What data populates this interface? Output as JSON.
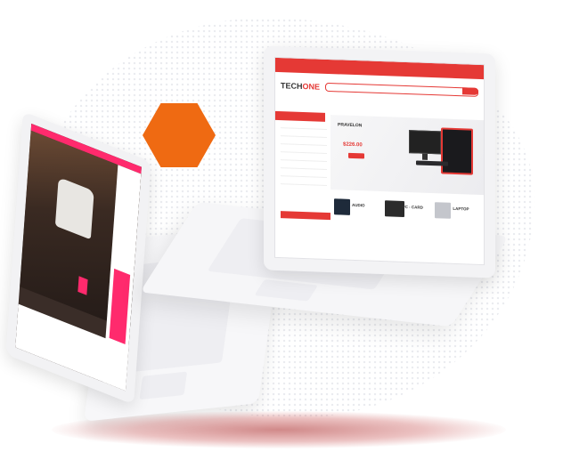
{
  "colors": {
    "accent_orange": "#ef6a12",
    "store_red": "#e53935",
    "fashion_pink": "#ff2a6d",
    "device_white": "#f6f6f8"
  },
  "right_screen": {
    "logo_main": "TECH",
    "logo_accent": "ONE",
    "banner_brand": "PRAVELON",
    "banner_price": "$226.00",
    "products": [
      "AUDIO",
      "PC - CARD",
      "LAPTOP"
    ]
  }
}
